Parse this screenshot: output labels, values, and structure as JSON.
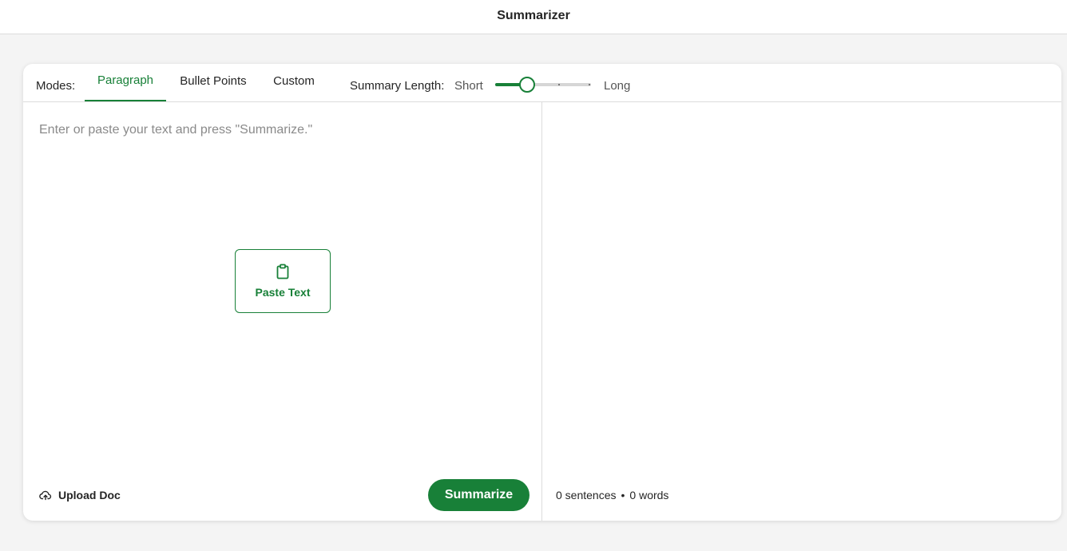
{
  "header": {
    "title": "Summarizer"
  },
  "toolbar": {
    "modes_label": "Modes:",
    "tabs": [
      {
        "label": "Paragraph",
        "active": true
      },
      {
        "label": "Bullet Points",
        "active": false
      },
      {
        "label": "Custom",
        "active": false
      }
    ],
    "summary_length_label": "Summary Length:",
    "short_label": "Short",
    "long_label": "Long",
    "summary_length_value": 0.33
  },
  "input": {
    "placeholder": "Enter or paste your text and press \"Summarize.\"",
    "value": ""
  },
  "paste_button": {
    "label": "Paste Text",
    "icon": "clipboard-icon"
  },
  "upload": {
    "label": "Upload Doc",
    "icon": "cloud-upload-icon"
  },
  "summarize_button": {
    "label": "Summarize"
  },
  "output_stats": {
    "sentences": "0 sentences",
    "separator": "•",
    "words": "0 words"
  },
  "colors": {
    "accent": "#188038",
    "background": "#f4f4f4",
    "surface": "#ffffff",
    "border": "#dcdcdc"
  }
}
